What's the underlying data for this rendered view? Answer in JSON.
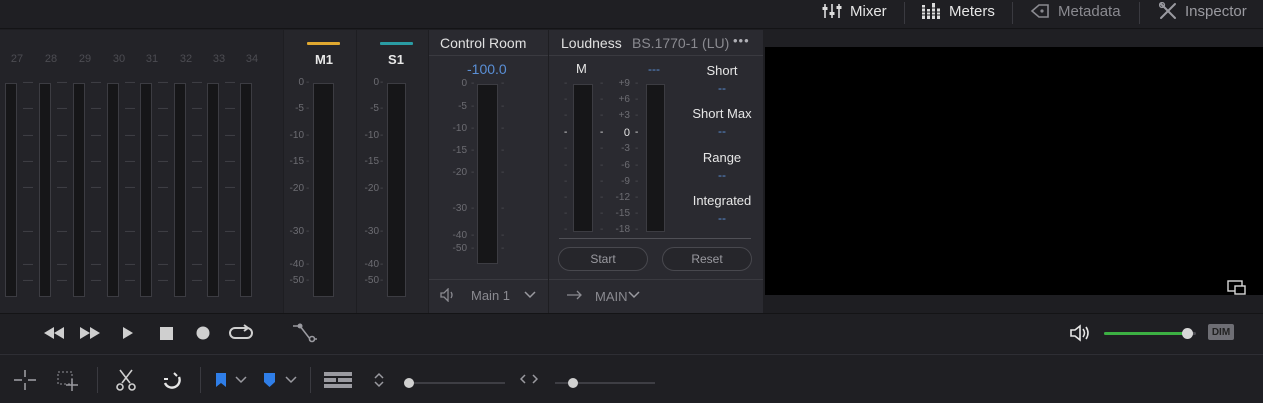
{
  "tabs": [
    {
      "label": "Mixer",
      "icon": "mixer-icon"
    },
    {
      "label": "Meters",
      "icon": "meters-icon"
    },
    {
      "label": "Metadata",
      "icon": "metadata-icon"
    },
    {
      "label": "Inspector",
      "icon": "inspector-icon"
    }
  ],
  "channels": [
    "27",
    "28",
    "29",
    "30",
    "31",
    "32",
    "33",
    "34"
  ],
  "meter_scale": [
    "0",
    "-5",
    "-10",
    "-15",
    "-20",
    "-30",
    "-40",
    "-50"
  ],
  "buses": [
    {
      "label": "M1",
      "color": "#e0a830"
    },
    {
      "label": "S1",
      "color": "#2a9ca4"
    }
  ],
  "control_room": {
    "title": "Control Room",
    "level": "-100.0",
    "scale": [
      "0",
      "-5",
      "-10",
      "-15",
      "-20",
      "-30",
      "-40",
      "-50"
    ],
    "output": "Main 1"
  },
  "loudness": {
    "title": "Loudness",
    "standard": "BS.1770-1 (LU)",
    "more": "•••",
    "meter_label": "M",
    "meter2_label": "---",
    "scale": [
      "+9",
      "+6",
      "+3",
      "0",
      "-3",
      "-6",
      "-9",
      "-12",
      "-15",
      "-18"
    ],
    "stats": [
      {
        "label": "Short",
        "value": "--"
      },
      {
        "label": "Short Max",
        "value": "--"
      },
      {
        "label": "Range",
        "value": "--"
      },
      {
        "label": "Integrated",
        "value": "--"
      }
    ],
    "start": "Start",
    "reset": "Reset",
    "bus": "MAIN"
  },
  "transport": {
    "dim": "DIM",
    "volume_fraction": 0.9
  },
  "colors": {
    "accent_green": "#3cb043",
    "flag_blue": "#2f7ee8",
    "value_blue": "#5a8fd6"
  }
}
